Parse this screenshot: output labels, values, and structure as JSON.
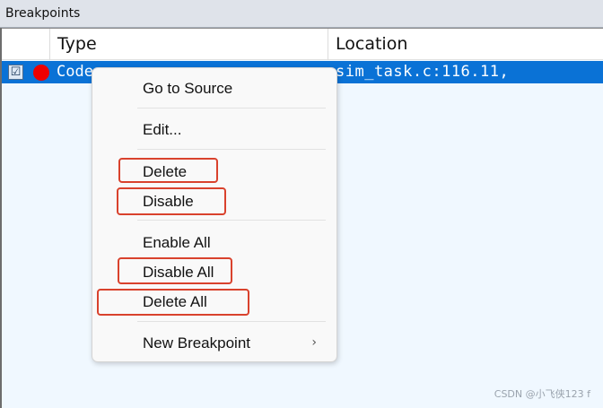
{
  "window": {
    "title": "Breakpoints"
  },
  "table": {
    "columns": [
      "Type",
      "Location"
    ],
    "rows": [
      {
        "checked": true,
        "checkbox_glyph": "☑",
        "enabled_icon": "breakpoint-dot-icon",
        "type": "Code",
        "location": "sim_task.c:116.11,"
      }
    ]
  },
  "context_menu": {
    "items": [
      {
        "label": "Go to Source"
      },
      {
        "label": "Edit..."
      },
      {
        "label": "Delete"
      },
      {
        "label": "Disable"
      },
      {
        "label": "Enable All"
      },
      {
        "label": "Disable All"
      },
      {
        "label": "Delete All"
      },
      {
        "label": "New Breakpoint",
        "submenu": "›"
      }
    ]
  },
  "colors": {
    "selection": "#0a72d6",
    "breakpoint_dot": "#ee0000",
    "annotation": "#d9422d"
  },
  "watermark": "CSDN @小飞侠123 f"
}
